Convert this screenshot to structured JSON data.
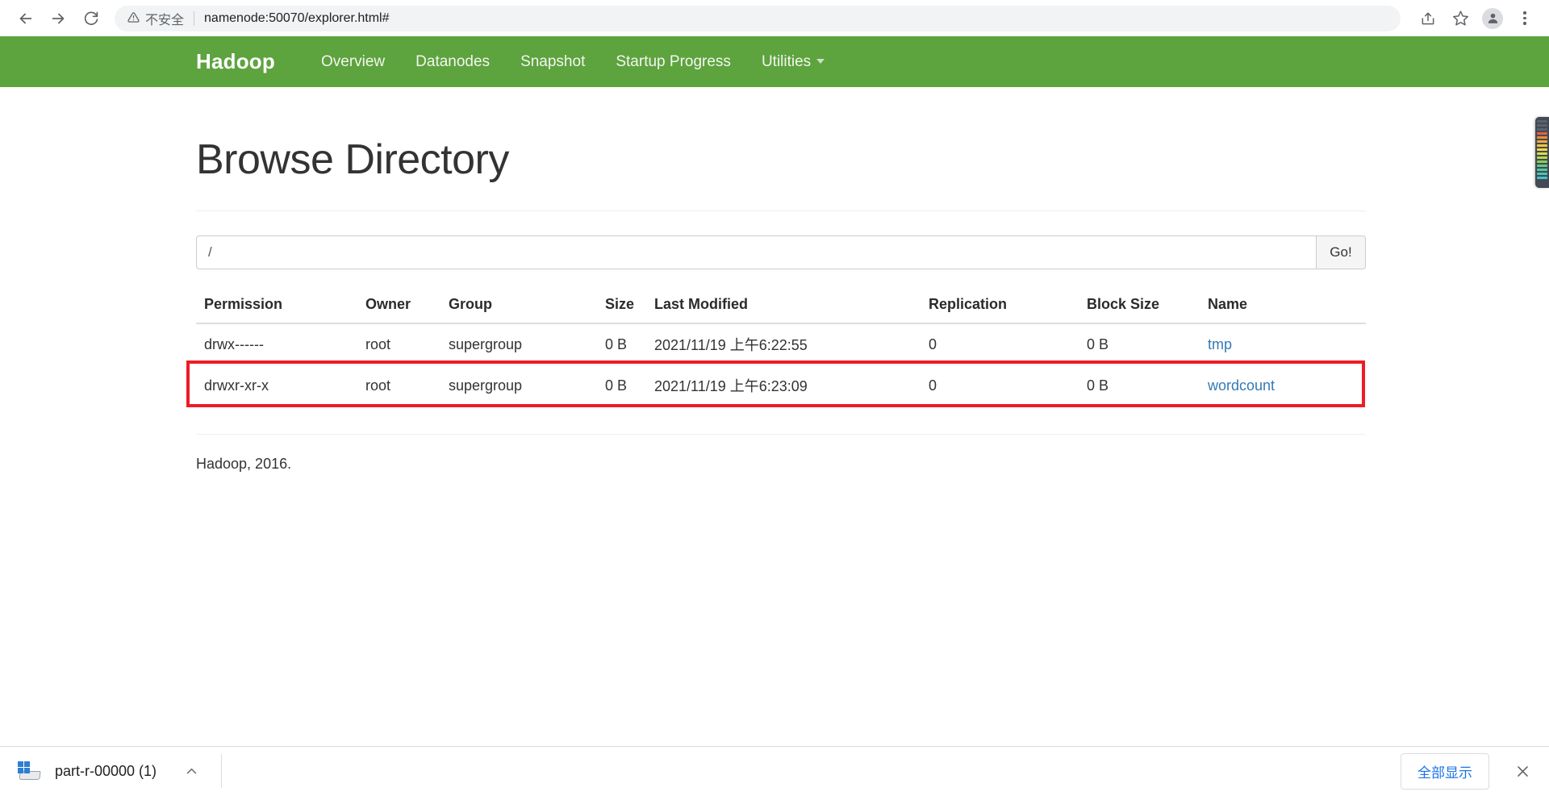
{
  "browser": {
    "back_icon": "arrow-left-icon",
    "forward_icon": "arrow-right-icon",
    "reload_icon": "reload-icon",
    "security_icon": "warning-triangle-icon",
    "security_label": "不安全",
    "url": "namenode:50070/explorer.html#",
    "share_icon": "share-icon",
    "bookmark_icon": "star-icon",
    "profile_icon": "avatar-icon",
    "menu_icon": "kebab-menu-icon"
  },
  "navbar": {
    "brand": "Hadoop",
    "links": [
      {
        "label": "Overview"
      },
      {
        "label": "Datanodes"
      },
      {
        "label": "Snapshot"
      },
      {
        "label": "Startup Progress"
      },
      {
        "label": "Utilities",
        "has_caret": true
      }
    ],
    "background_color": "#5da33e"
  },
  "main": {
    "title": "Browse Directory",
    "path_input": {
      "value": "/",
      "placeholder": ""
    },
    "go_button": "Go!",
    "table": {
      "headers": [
        "Permission",
        "Owner",
        "Group",
        "Size",
        "Last Modified",
        "Replication",
        "Block Size",
        "Name"
      ],
      "rows": [
        {
          "permission": "drwx------",
          "owner": "root",
          "group": "supergroup",
          "size": "0 B",
          "last_modified": "2021/11/19 上午6:22:55",
          "replication": "0",
          "block_size": "0 B",
          "name": "tmp"
        },
        {
          "permission": "drwxr-xr-x",
          "owner": "root",
          "group": "supergroup",
          "size": "0 B",
          "last_modified": "2021/11/19 上午6:23:09",
          "replication": "0",
          "block_size": "0 B",
          "name": "wordcount"
        }
      ]
    },
    "footer": "Hadoop, 2016."
  },
  "annotation": {
    "color": "#ee1c25",
    "target_row_index": 1
  },
  "edge_widget": {
    "colors": [
      "#5b6270",
      "#5b6270",
      "#5b6270",
      "#e8603c",
      "#ef8a3a",
      "#f2a93b",
      "#f4c63d",
      "#f0d843",
      "#d9dc46",
      "#b5d84a",
      "#86ce5a",
      "#5ec munge",
      "#4ec9a0",
      "#45c6b8",
      "#43c2c8"
    ]
  },
  "download_shelf": {
    "file_icon": "windows-file-icon",
    "file_name": "part-r-00000 (1)",
    "chevron_icon": "chevron-up-icon",
    "show_all_label": "全部显示",
    "close_icon": "close-icon"
  }
}
